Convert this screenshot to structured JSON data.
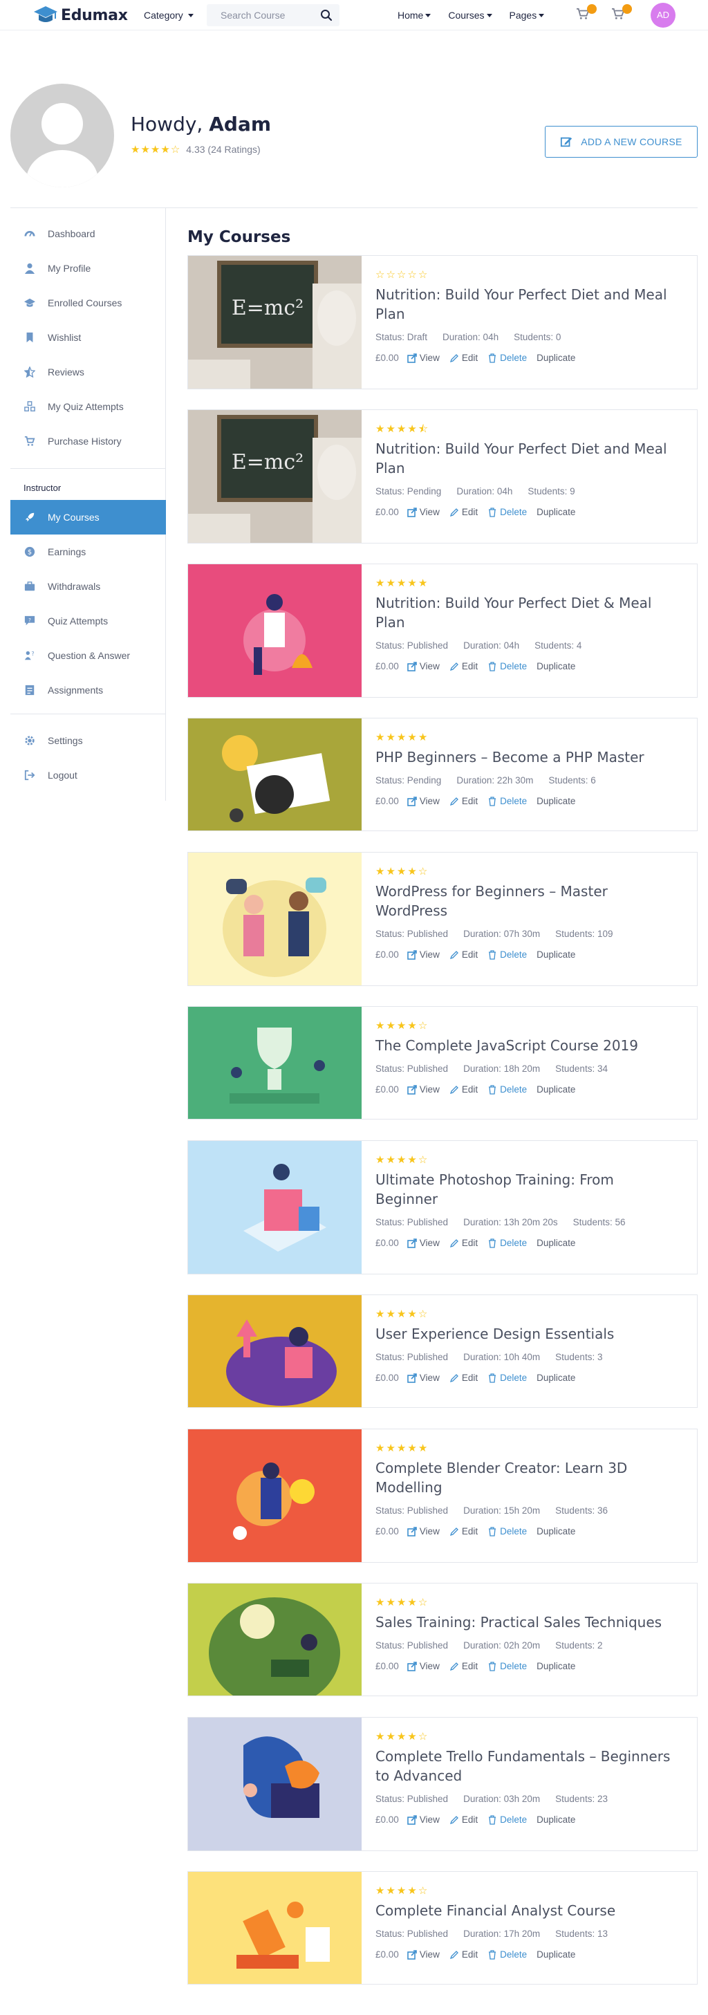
{
  "brand": {
    "name": "Edumax",
    "accent": "#3e8fcf",
    "star_color": "#f8c51c"
  },
  "header": {
    "category_label": "Category",
    "search_placeholder": "Search Course",
    "nav": [
      "Home",
      "Courses",
      "Pages"
    ],
    "cart1_count": "",
    "cart2_count": "",
    "user_initials": "AD"
  },
  "profile": {
    "greeting": "Howdy,",
    "name": "Adam",
    "rating_text": "4.33 (24 Ratings)",
    "rating": 4.33,
    "add_course_label": "ADD A NEW COURSE"
  },
  "sidebar": {
    "items": [
      {
        "label": "Dashboard",
        "icon": "dashboard-icon"
      },
      {
        "label": "My Profile",
        "icon": "user-icon"
      },
      {
        "label": "Enrolled Courses",
        "icon": "graduation-cap-icon"
      },
      {
        "label": "Wishlist",
        "icon": "bookmark-icon"
      },
      {
        "label": "Reviews",
        "icon": "star-half-icon"
      },
      {
        "label": "My Quiz Attempts",
        "icon": "quiz-icon"
      },
      {
        "label": "Purchase History",
        "icon": "cart-icon"
      }
    ],
    "instructor_heading": "Instructor",
    "instructor_items": [
      {
        "label": "My Courses",
        "icon": "rocket-icon",
        "active": true
      },
      {
        "label": "Earnings",
        "icon": "coin-icon"
      },
      {
        "label": "Withdrawals",
        "icon": "briefcase-icon"
      },
      {
        "label": "Quiz Attempts",
        "icon": "quiz-chat-icon"
      },
      {
        "label": "Question & Answer",
        "icon": "question-icon"
      },
      {
        "label": "Assignments",
        "icon": "assignment-icon"
      }
    ],
    "footer_items": [
      {
        "label": "Settings",
        "icon": "gear-icon"
      },
      {
        "label": "Logout",
        "icon": "logout-icon"
      }
    ]
  },
  "main": {
    "title": "My Courses",
    "labels": {
      "view": "View",
      "edit": "Edit",
      "delete": "Delete",
      "duplicate": "Duplicate"
    },
    "courses": [
      {
        "title": "Nutrition: Build Your Perfect Diet and Meal Plan",
        "status": "Status: Draft",
        "duration": "Duration: 04h",
        "students": "Students: 0",
        "price": "£0.00",
        "rating": 0,
        "thumb_color": "#8b7b6b"
      },
      {
        "title": "Nutrition: Build Your Perfect Diet and Meal Plan",
        "status": "Status: Pending",
        "duration": "Duration: 04h",
        "students": "Students: 9",
        "price": "£0.00",
        "rating": 4.5,
        "thumb_color": "#8b7b6b"
      },
      {
        "title": "Nutrition: Build Your Perfect Diet & Meal Plan",
        "status": "Status: Published",
        "duration": "Duration: 04h",
        "students": "Students: 4",
        "price": "£0.00",
        "rating": 5,
        "thumb_color": "#e84c7d"
      },
      {
        "title": "PHP Beginners – Become a PHP Master",
        "status": "Status: Pending",
        "duration": "Duration: 22h 30m",
        "students": "Students: 6",
        "price": "£0.00",
        "rating": 5,
        "thumb_color": "#a9a63a"
      },
      {
        "title": "WordPress for Beginners – Master WordPress",
        "status": "Status: Published",
        "duration": "Duration: 07h 30m",
        "students": "Students: 109",
        "price": "£0.00",
        "rating": 4,
        "thumb_color": "#fdf5c4"
      },
      {
        "title": "The Complete JavaScript Course 2019",
        "status": "Status: Published",
        "duration": "Duration: 18h 20m",
        "students": "Students: 34",
        "price": "£0.00",
        "rating": 4,
        "thumb_color": "#4caf7a"
      },
      {
        "title": "Ultimate Photoshop Training: From Beginner",
        "status": "Status: Published",
        "duration": "Duration: 13h 20m 20s",
        "students": "Students: 56",
        "price": "£0.00",
        "rating": 4,
        "thumb_color": "#bfe2f7"
      },
      {
        "title": "User Experience Design Essentials",
        "status": "Status: Published",
        "duration": "Duration: 10h 40m",
        "students": "Students: 3",
        "price": "£0.00",
        "rating": 4,
        "thumb_color": "#e5b42e"
      },
      {
        "title": "Complete Blender Creator: Learn 3D Modelling",
        "status": "Status: Published",
        "duration": "Duration: 15h 20m",
        "students": "Students: 36",
        "price": "£0.00",
        "rating": 5,
        "thumb_color": "#ee5a3f"
      },
      {
        "title": "Sales Training: Practical Sales Techniques",
        "status": "Status: Published",
        "duration": "Duration: 02h 20m",
        "students": "Students: 2",
        "price": "£0.00",
        "rating": 4,
        "thumb_color": "#c3cf4b"
      },
      {
        "title": "Complete Trello Fundamentals – Beginners to Advanced",
        "status": "Status: Published",
        "duration": "Duration: 03h 20m",
        "students": "Students: 23",
        "price": "£0.00",
        "rating": 4,
        "thumb_color": "#cdd3e8"
      },
      {
        "title": "Complete Financial Analyst Course",
        "status": "Status: Published",
        "duration": "Duration: 17h 20m",
        "students": "Students: 13",
        "price": "£0.00",
        "rating": 4,
        "thumb_color": "#fde17b"
      }
    ]
  }
}
